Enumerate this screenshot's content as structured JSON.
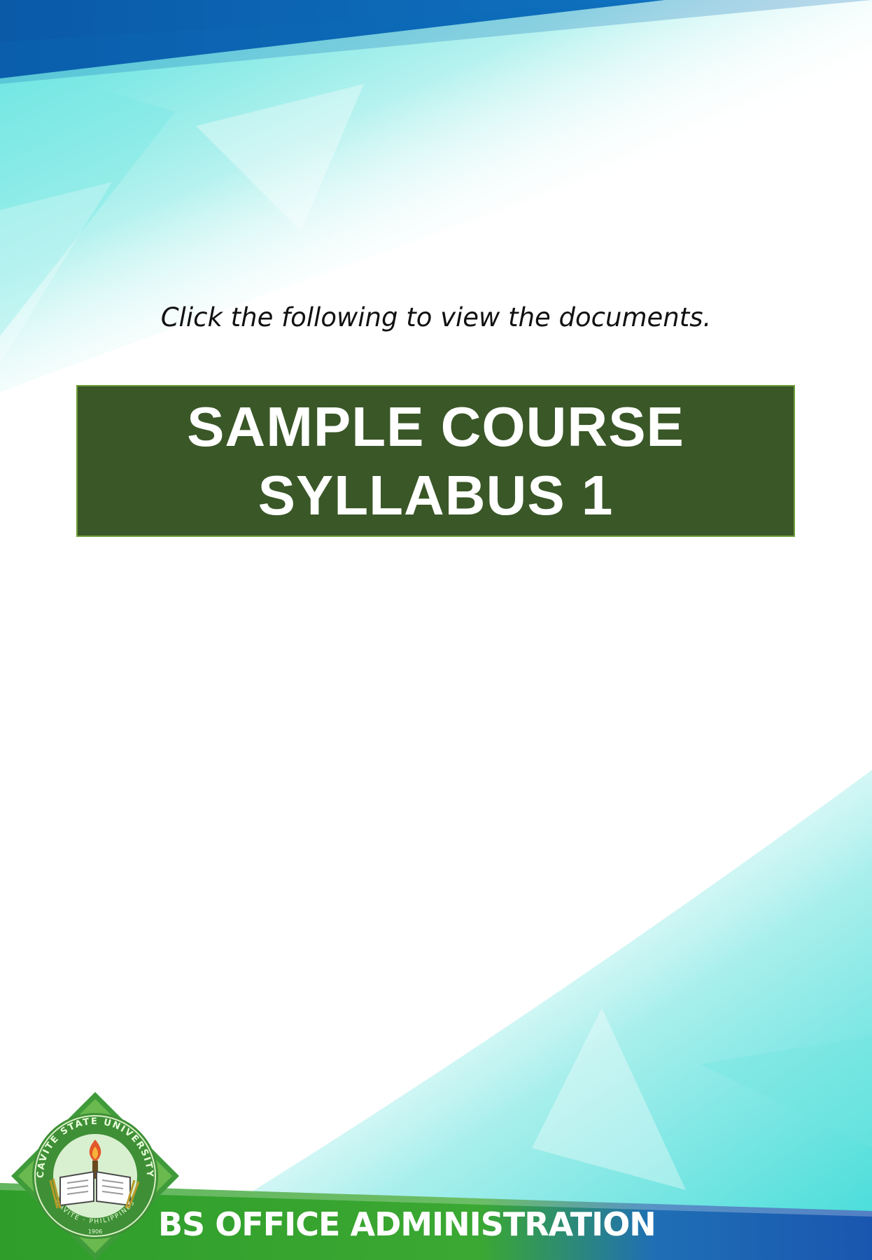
{
  "page": {
    "instruction": "Click the following to view the documents.",
    "document_button": {
      "line1": "SAMPLE COURSE",
      "line2": "SYLLABUS 1"
    },
    "footer_title": "BS OFFICE ADMINISTRATION",
    "seal": {
      "ring_text_top": "CAVITE STATE UNIVERSITY",
      "ring_text_bottom": "CAVITE · PHILIPPINES",
      "year": "1906"
    }
  },
  "colors": {
    "button_bg": "#3a5727",
    "footer_blue": "#1a4fa8",
    "footer_green": "#2d9a2a",
    "header_blue": "#0a63b0",
    "aqua": "#5fe3e0"
  }
}
